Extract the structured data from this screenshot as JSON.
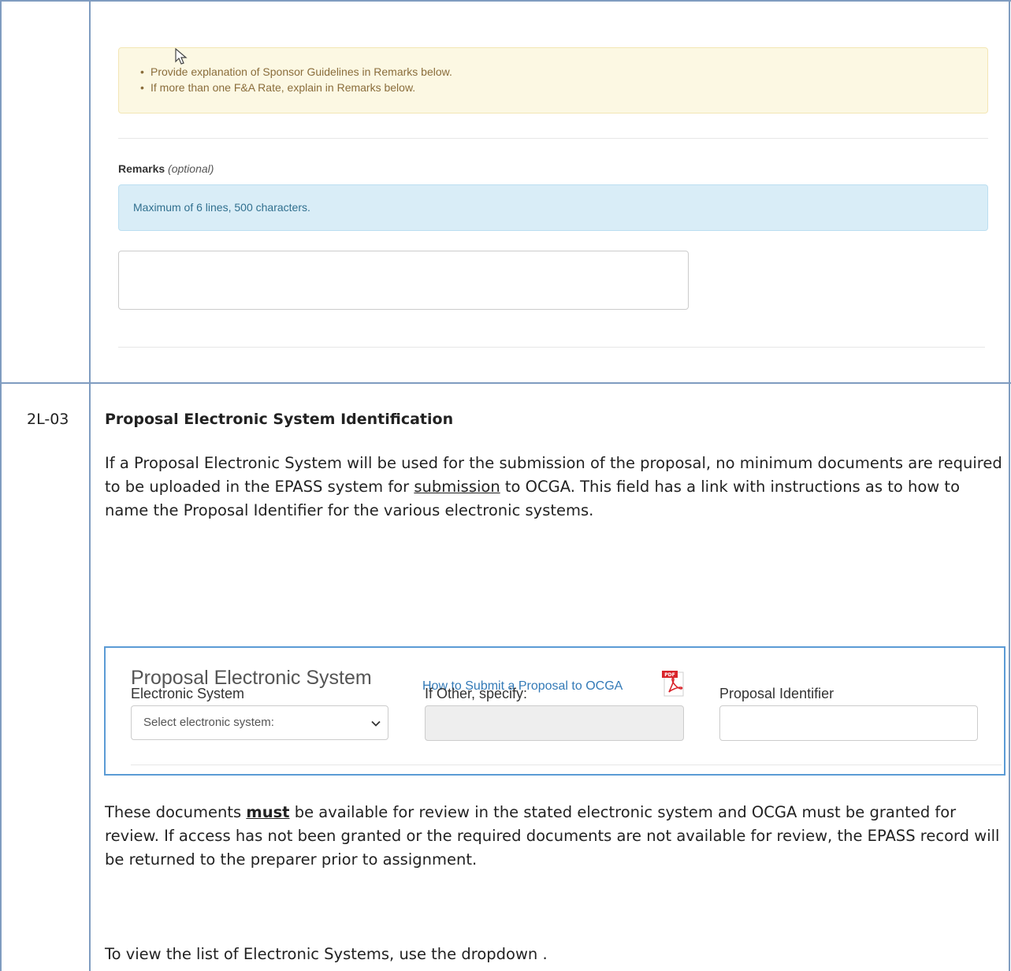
{
  "top_panel": {
    "notes": [
      "Provide explanation of Sponsor Guidelines in Remarks below.",
      "If more than one F&A Rate, explain in Remarks below."
    ],
    "remarks_label": "Remarks",
    "remarks_optional": "(optional)",
    "remarks_info": "Maximum of 6 lines, 500 characters.",
    "remarks_value": ""
  },
  "row": {
    "id": "2L-03",
    "title": "Proposal Electronic System Identification",
    "para1_a": "If a Proposal Electronic System will be used for the submission of the proposal, no minimum documents are required to be uploaded in the EPASS system for ",
    "para1_u": "submission",
    "para1_b": " to OCGA.  This field has a link with instructions as to how to name the Proposal Identifier for the various electronic systems.",
    "para2_a": "These documents ",
    "para2_bold": "must",
    "para2_b": " be available for review in the stated electronic system and OCGA must be granted for review.  If access has not been granted or the required documents are not available for review, the EPASS record will be returned to the preparer prior to assignment.",
    "para3": "To view the list of Electronic Systems, use the dropdown ."
  },
  "pes_panel": {
    "title": "Proposal Electronic System",
    "link": "How to Submit a Proposal to OCGA",
    "electronic_system_label": "Electronic System",
    "electronic_system_selected": "Select electronic system:",
    "other_label": "If Other, specify:",
    "other_value": "",
    "identifier_label": "Proposal Identifier",
    "identifier_value": ""
  },
  "icons": {
    "pdf": "pdf-file-icon",
    "chevron": "chevron-down-icon",
    "cursor": "mouse-pointer-icon"
  },
  "colors": {
    "table_border": "#7f9cc0",
    "warning_bg": "#fcf8e3",
    "info_bg": "#d9edf7",
    "panel_border": "#5b9bd5",
    "link": "#337ab7"
  }
}
